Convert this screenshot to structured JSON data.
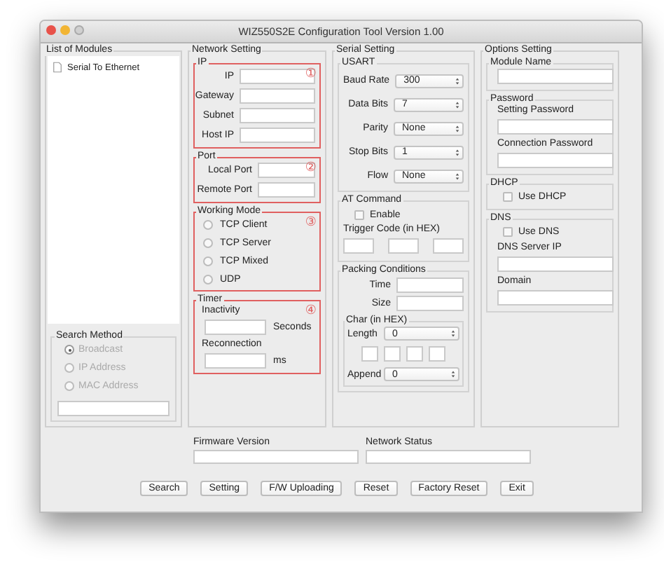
{
  "window": {
    "title": "WIZ550S2E Configuration Tool Version 1.00"
  },
  "modules": {
    "title": "List of Modules",
    "items": [
      {
        "label": "Serial To Ethernet",
        "selected": false
      }
    ]
  },
  "search_method": {
    "title": "Search Method",
    "options": [
      {
        "label": "Broadcast",
        "selected": true,
        "disabled": true
      },
      {
        "label": "IP Address",
        "selected": false,
        "disabled": true
      },
      {
        "label": "MAC Address",
        "selected": false,
        "disabled": true
      }
    ]
  },
  "network_setting": {
    "title": "Network Setting",
    "groups": [
      {
        "kind": "fields",
        "title": "IP",
        "badge": "①",
        "highlighted": true,
        "fields": [
          "IP",
          "Gateway",
          "Subnet",
          "Host IP"
        ]
      },
      {
        "kind": "fields",
        "title": "Port",
        "badge": "②",
        "highlighted": true,
        "fields": [
          "Local Port",
          "Remote Port"
        ]
      },
      {
        "kind": "radios",
        "title": "Working Mode",
        "badge": "③",
        "highlighted": true,
        "options": [
          {
            "label": "TCP Client",
            "selected": false
          },
          {
            "label": "TCP Server",
            "selected": false
          },
          {
            "label": "TCP Mixed",
            "selected": false
          },
          {
            "label": "UDP",
            "selected": false
          }
        ]
      },
      {
        "kind": "timer",
        "title": "Timer",
        "badge": "④",
        "highlighted": true,
        "fields": [
          {
            "label": "Inactivity",
            "unit": "Seconds"
          },
          {
            "label": "Reconnection",
            "unit": "ms"
          }
        ]
      }
    ]
  },
  "serial_setting": {
    "title": "Serial Setting",
    "usart": {
      "title": "USART",
      "rows": [
        {
          "label": "Baud Rate",
          "value": "300"
        },
        {
          "label": "Data Bits",
          "value": "7"
        },
        {
          "label": "Parity",
          "value": "None"
        },
        {
          "label": "Stop Bits",
          "value": "1"
        },
        {
          "label": "Flow",
          "value": "None"
        }
      ]
    },
    "at_command": {
      "title": "AT Command",
      "enable": {
        "label": "Enable",
        "checked": false
      },
      "trigger_label": "Trigger Code (in HEX)"
    },
    "packing": {
      "title": "Packing Conditions",
      "fields": [
        "Time",
        "Size"
      ],
      "char": {
        "title": "Char (in HEX)",
        "length": {
          "label": "Length",
          "value": "0"
        },
        "append": {
          "label": "Append",
          "value": "0"
        }
      }
    }
  },
  "options_setting": {
    "title": "Options Setting",
    "groups": [
      {
        "title": "Module Name",
        "items": [
          {
            "kind": "field"
          }
        ]
      },
      {
        "title": "Password",
        "items": [
          {
            "kind": "label",
            "text": "Setting Password"
          },
          {
            "kind": "field"
          },
          {
            "kind": "label",
            "text": "Connection Password"
          },
          {
            "kind": "field"
          }
        ]
      },
      {
        "title": "DHCP",
        "items": [
          {
            "kind": "check",
            "text": "Use DHCP",
            "checked": false
          }
        ]
      },
      {
        "title": "DNS",
        "items": [
          {
            "kind": "check",
            "text": "Use DNS",
            "checked": false
          },
          {
            "kind": "label",
            "text": "DNS Server IP"
          },
          {
            "kind": "field"
          },
          {
            "kind": "label",
            "text": "Domain"
          },
          {
            "kind": "field"
          }
        ]
      }
    ]
  },
  "firmware_version": {
    "label": "Firmware Version"
  },
  "network_status": {
    "label": "Network Status"
  },
  "buttons": [
    "Search",
    "Setting",
    "F/W Uploading",
    "Reset",
    "Factory Reset",
    "Exit"
  ]
}
